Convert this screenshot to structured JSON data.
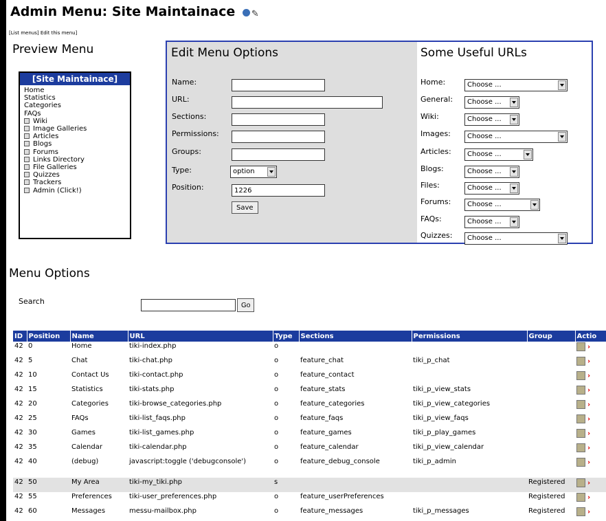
{
  "page": {
    "title": "Admin Menu: Site Maintainace",
    "links": [
      "[List menus]",
      "Edit this menu]"
    ],
    "preview_heading": "Preview Menu"
  },
  "preview_menu": {
    "header": "[Site Maintainace]",
    "items": [
      {
        "label": "Home",
        "expandable": false
      },
      {
        "label": "Statistics",
        "expandable": false
      },
      {
        "label": "Categories",
        "expandable": false
      },
      {
        "label": "FAQs",
        "expandable": false
      },
      {
        "label": "Wiki",
        "expandable": true
      },
      {
        "label": "Image Galleries",
        "expandable": true
      },
      {
        "label": "Articles",
        "expandable": true
      },
      {
        "label": "Blogs",
        "expandable": true
      },
      {
        "label": "Forums",
        "expandable": true
      },
      {
        "label": "Links Directory",
        "expandable": true
      },
      {
        "label": "File Galleries",
        "expandable": true
      },
      {
        "label": "Quizzes",
        "expandable": true
      },
      {
        "label": "Trackers",
        "expandable": true
      },
      {
        "label": "Admin (Click!)",
        "expandable": true
      }
    ]
  },
  "edit": {
    "heading": "Edit Menu Options",
    "name_label": "Name:",
    "url_label": "URL:",
    "sections_label": "Sections:",
    "permissions_label": "Permissions:",
    "groups_label": "Groups:",
    "type_label": "Type:",
    "position_label": "Position:",
    "name_value": "",
    "url_value": "",
    "sections_value": "",
    "permissions_value": "",
    "groups_value": "",
    "type_value": "option",
    "position_value": "1226",
    "save_label": "Save"
  },
  "urls": {
    "heading": "Some Useful URLs",
    "rows": [
      {
        "label": "Home:",
        "value": "Choose ..."
      },
      {
        "label": "General:",
        "value": "Choose ..."
      },
      {
        "label": "Wiki:",
        "value": "Choose ..."
      },
      {
        "label": "Images:",
        "value": "Choose ..."
      },
      {
        "label": "Articles:",
        "value": "Choose ..."
      },
      {
        "label": "Blogs:",
        "value": "Choose ..."
      },
      {
        "label": "Files:",
        "value": "Choose ..."
      },
      {
        "label": "Forums:",
        "value": "Choose ..."
      },
      {
        "label": "FAQs:",
        "value": "Choose ..."
      },
      {
        "label": "Quizzes:",
        "value": "Choose ..."
      }
    ]
  },
  "options": {
    "heading": "Menu Options",
    "search_label": "Search",
    "search_value": "",
    "go_label": "Go",
    "columns": [
      "ID",
      "Position",
      "Name",
      "URL",
      "Type",
      "Sections",
      "Permissions",
      "Group",
      "Actio"
    ],
    "rows": [
      {
        "id": "42",
        "position": "0",
        "name": "Home",
        "url": "tiki-index.php",
        "type": "o",
        "sections": "",
        "permissions": "",
        "group": ""
      },
      {
        "id": "42",
        "position": "5",
        "name": "Chat",
        "url": "tiki-chat.php",
        "type": "o",
        "sections": "feature_chat",
        "permissions": "tiki_p_chat",
        "group": ""
      },
      {
        "id": "42",
        "position": "10",
        "name": "Contact Us",
        "url": "tiki-contact.php",
        "type": "o",
        "sections": "feature_contact",
        "permissions": "",
        "group": ""
      },
      {
        "id": "42",
        "position": "15",
        "name": "Statistics",
        "url": "tiki-stats.php",
        "type": "o",
        "sections": "feature_stats",
        "permissions": "tiki_p_view_stats",
        "group": ""
      },
      {
        "id": "42",
        "position": "20",
        "name": "Categories",
        "url": "tiki-browse_categories.php",
        "type": "o",
        "sections": "feature_categories",
        "permissions": "tiki_p_view_categories",
        "group": ""
      },
      {
        "id": "42",
        "position": "25",
        "name": "FAQs",
        "url": "tiki-list_faqs.php",
        "type": "o",
        "sections": "feature_faqs",
        "permissions": "tiki_p_view_faqs",
        "group": ""
      },
      {
        "id": "42",
        "position": "30",
        "name": "Games",
        "url": "tiki-list_games.php",
        "type": "o",
        "sections": "feature_games",
        "permissions": "tiki_p_play_games",
        "group": ""
      },
      {
        "id": "42",
        "position": "35",
        "name": "Calendar",
        "url": "tiki-calendar.php",
        "type": "o",
        "sections": "feature_calendar",
        "permissions": "tiki_p_view_calendar",
        "group": ""
      },
      {
        "id": "42",
        "position": "40",
        "name": "(debug)",
        "url": "javascript:toggle ('debugconsole')",
        "type": "o",
        "sections": "feature_debug_console",
        "permissions": "tiki_p_admin",
        "group": ""
      },
      {
        "id": "42",
        "position": "50",
        "name": "My Area",
        "url": "tiki-my_tiki.php",
        "type": "s",
        "sections": "",
        "permissions": "",
        "group": "Registered"
      },
      {
        "id": "42",
        "position": "55",
        "name": "Preferences",
        "url": "tiki-user_preferences.php",
        "type": "o",
        "sections": "feature_userPreferences",
        "permissions": "",
        "group": "Registered"
      },
      {
        "id": "42",
        "position": "60",
        "name": "Messages",
        "url": "messu-mailbox.php",
        "type": "o",
        "sections": "feature_messages",
        "permissions": "tiki_p_messages",
        "group": "Registered"
      }
    ]
  },
  "colors": {
    "header_blue": "#1c3c9e",
    "box_border": "#2a3fb0",
    "edit_panel_gray": "#dedede",
    "delete_red": "#dd0000"
  }
}
